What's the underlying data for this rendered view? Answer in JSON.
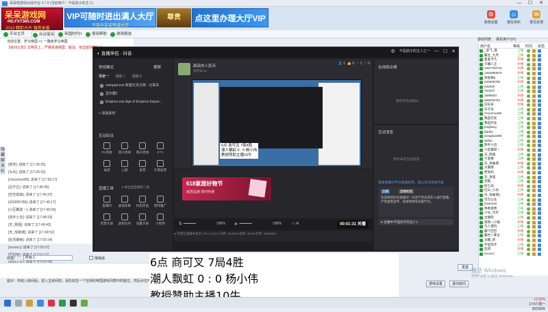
{
  "window": {
    "title": "呆呆啦游戏对战平台 4.7.9 (当前用户：不是鸽子的主人)",
    "controls": [
      "—",
      "☐",
      "✕"
    ]
  },
  "banner": {
    "logo_title": "呆呆游戏网",
    "logo_url": "HD.FXT365.COM",
    "logo_tag": "2013 精彩大片 强势来袭",
    "ad1_main": "VIP可随时进出满人大厅",
    "ad1_sub": "不用辛苦苦等进大厅",
    "ad2": "尊贵",
    "ad3": "点这里办理大厅VIP"
  },
  "toolbar_right": [
    {
      "label": "系统设置",
      "icon": "gear-icon",
      "color": "#e04b3a"
    },
    {
      "label": "填写资料",
      "icon": "profile-icon",
      "color": "#3a8de0"
    },
    {
      "label": "意见反馈",
      "icon": "feedback-icon",
      "color": "#e0a23a"
    }
  ],
  "tabs": [
    "平台主页",
    "欢迎使用",
    "帝国时代II",
    "使用帮助",
    "游戏精选"
  ],
  "right_tabs": [
    "游戏列表",
    "联机用户(97)"
  ],
  "chat": {
    "address": "当前位置：罗马帝国 >> 一路炼罗马帝国",
    "notice": "【房间公告】文明至上，严禁恶意刷屏、脏话、攻击辱骂等行为",
    "messages": [
      "[吴忠]: 进来了 [17:35:25]",
      "[大兵]: 进来了 [17:35:32]",
      "[chuochuo89]: 进来了 [17:36:17]",
      "[吕不正]: 进来了 [17:40:35]",
      "[空空劫掠]: 进来了 [17:40:37]",
      "[420005786]: 进来了 [17:45:17]",
      "[小区霸道丶]: 进来了 [17:45:54]",
      "[快手小丑]: 进来了 [17:48:33]",
      "[天_刚强]: 进来了 [17:49:43]",
      "[天_攻破城]: 进来了 [17:49:52]",
      "[狂风暴雨]: 进来了 [17:50:14]",
      "[nnoocc]: 进来了 [17:50:37]",
      "[巴拉啦]: 进来了 [17:52:12]",
      "[可可公主]: 进来了 [17:53:29]"
    ],
    "side_label": "隐藏聊天栏",
    "to_label": "对话：",
    "to_value": "所有人",
    "private_label": "悄悄话",
    "send": "发送",
    "hint": "提示：你进入房间后，进入主房间前，请先双击一个空闲的帝国游戏列表中的座位，然后点击开始按钮即可。"
  },
  "bottom_buttons": [
    "游戏设置",
    "退出房间"
  ],
  "userlist": {
    "headers": [
      "用户名",
      "等级",
      "时间",
      "状态"
    ],
    "rows": [
      [
        "_浪飞_落",
        "上将",
        "#3a3"
      ],
      [
        "霸主_九月",
        "上将",
        "#3a3"
      ],
      [
        "麦麦不凡",
        "大将",
        "#c33"
      ],
      [
        "千嫌人王",
        "大将",
        "#c33"
      ],
      [
        "1357793734",
        "大将",
        "#c33"
      ],
      [
        "1362950676",
        "大将",
        "#c33"
      ],
      [
        "谢星辰9",
        "上将",
        "#3a3"
      ],
      [
        "420005786",
        "大将",
        "#c33"
      ],
      [
        "rst2020",
        "上将",
        "#3a3"
      ],
      [
        "752037",
        "上将",
        "#3a3"
      ],
      [
        "1586603",
        "大将",
        "#c33"
      ],
      [
        "a86005754",
        "大将",
        "#c33"
      ],
      [
        "刘志军",
        "大将",
        "#c33"
      ],
      [
        "天子兵",
        "上将",
        "#3a3"
      ],
      [
        "chuochuo89",
        "上将",
        "#3a3"
      ],
      [
        "我是打仗",
        "上将",
        "#3a3"
      ],
      [
        "我是打仗",
        "上将",
        "#3a3"
      ],
      [
        "pingfang",
        "上将",
        "#3a3"
      ],
      [
        "dadao",
        "上将",
        "#3a3"
      ],
      [
        "yongduan88",
        "上将",
        "#3a3"
      ],
      [
        "wkfqz",
        "上将",
        "#3a3"
      ],
      [
        "快手小丑",
        "上将",
        "#3a3"
      ],
      [
        "小区霸道丶",
        "大将",
        "#c33"
      ],
      [
        "天_刚强",
        "上将",
        "#3a3"
      ],
      [
        "千金难",
        "上将",
        "#3a3"
      ],
      [
        "天_攻破城",
        "大将",
        "#c33"
      ],
      [
        "大暴雨",
        "上将",
        "#3a3"
      ],
      [
        "老张鸡",
        "大将",
        "#c33"
      ],
      [
        "天_攻强",
        "上将",
        "#3a3"
      ],
      [
        "无敌",
        "上将",
        "#3a3"
      ],
      [
        "好士兵",
        "大将",
        "#c33"
      ],
      [
        "红山_小兵",
        "上将",
        "#3a3"
      ],
      [
        "天_攻破城1",
        "大将",
        "#c33"
      ],
      [
        "可可公主",
        "上将",
        "#3a3"
      ],
      [
        "hnwinner",
        "上将",
        "#3a3"
      ],
      [
        "乖乖黑帝",
        "上将",
        "#3a3"
      ],
      [
        "小号_可可",
        "上将",
        "#3a3"
      ],
      [
        "主播玩",
        "上将",
        "#3a3"
      ],
      [
        "黑暗一小笼",
        "大将",
        "#c33"
      ],
      [
        "凡人游玩",
        "上将",
        "#3a3"
      ],
      [
        "霸气巴巴",
        "大将",
        "#c33"
      ],
      [
        "霸世一拳主",
        "上将",
        "#3a3"
      ],
      [
        "天籁_阿",
        "大将",
        "#c33"
      ],
      [
        "不是鸽子",
        "上将",
        "#3a3"
      ],
      [
        "狂风",
        "大将",
        "#c33"
      ],
      [
        "nnoocc",
        "上将",
        "#3a3"
      ]
    ]
  },
  "watermark": {
    "line1": "激活 Windows",
    "line2": "转到\"设置\"以激活 Windows。"
  },
  "tray": {
    "time": "17:57 周一",
    "date": "2023/6/5",
    "net": "+0.50%"
  },
  "stream": {
    "app_name": "直播伴侣",
    "app_sub": "抖音",
    "titlebar_right": "不是鸽子的主人之一",
    "left": {
      "mode_label": "常规模式",
      "horizontal": "横屏",
      "scene_tabs": [
        "场景一",
        "场景二",
        "场景三"
      ],
      "sources": [
        "notepad.exe 新建文本文档 - 记事本",
        "显示器1",
        "Empires.exe Age of Empires Expan..."
      ],
      "add_source": "添加素材",
      "interact_title": "互动玩法",
      "interact_tools": [
        "PK连线",
        "观众连线",
        "观众连线",
        "KTV",
        "福袋",
        "心愿",
        "投票",
        "礼物投票"
      ],
      "live_tools_title": "直播工具",
      "live_tools_hint": "● 粉丝团直播第二屏",
      "live_tools": [
        "直播间",
        "虚拟形象",
        "抖店商品",
        "游戏推广",
        "智慧大屏",
        "虚拟任务",
        "设置大屏",
        "小程序"
      ]
    },
    "center": {
      "username": "颜高的人民币",
      "userid": "抖音号:12",
      "stats": [
        "👤 1",
        "👍 0",
        "♡ 1",
        "♡ 0"
      ],
      "nested_caption_lines": [
        "6点      商可叉     7局4胜",
        "潮人飘虹  0 :  0  杨小伟",
        "教授赞助主播10牛"
      ],
      "promo_title": "618家居好物节",
      "promo_sub": "家居品牌 限时特惠",
      "mic_pct": "100%",
      "sys_pct": "100%",
      "live_time": "00:01:31",
      "live_end": "关播",
      "status": "● 不想在直播中显示   CPU: 5.21%   内存: 39.60%   帧率: 30.00   码率: 2968kb/s"
    },
    "right": {
      "online_title": "在线观众榜",
      "online_empty": "暂时无在线观众",
      "msg_title": "互动消息",
      "msg_empty": "暂时未有互动消息",
      "rules": "直播请遵守平台直播规范，禁止违法违规内容",
      "badge1": "主播",
      "badge2": "直播助理",
      "chat_msg": "欢迎来到抖音直播间！抖音严禁未成年人进行直播，严禁虚假宣传、低俗色情等违规行为。",
      "bottom": "● 主播中/不是鸽子的主人1"
    }
  },
  "overlay": {
    "line1": "6点          商可叉          7局4胜",
    "line2": "潮人飘虹   0   :   0    杨小伟",
    "line3": "教授赞助主播10牛"
  }
}
